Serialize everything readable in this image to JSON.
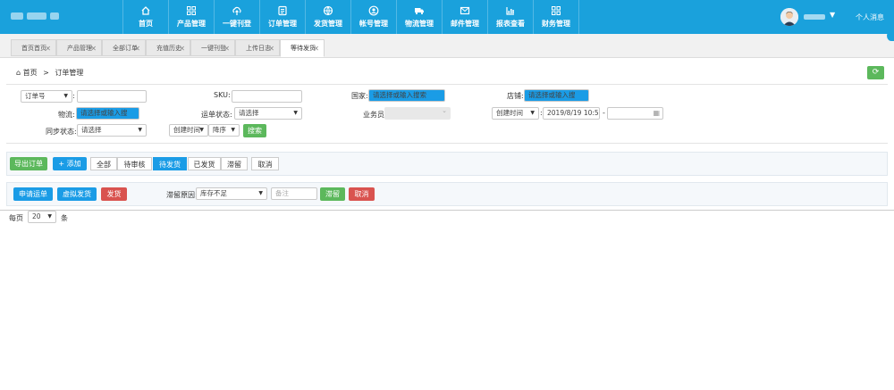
{
  "nav": [
    {
      "label": "首页",
      "icon": "home-icon"
    },
    {
      "label": "产品管理",
      "icon": "grid-icon"
    },
    {
      "label": "一键刊登",
      "icon": "cloud-upload-icon"
    },
    {
      "label": "订单管理",
      "icon": "document-icon"
    },
    {
      "label": "发货管理",
      "icon": "globe-icon"
    },
    {
      "label": "帐号管理",
      "icon": "user-icon"
    },
    {
      "label": "物流管理",
      "icon": "truck-icon"
    },
    {
      "label": "邮件管理",
      "icon": "mail-icon"
    },
    {
      "label": "报表查看",
      "icon": "report-icon"
    },
    {
      "label": "财务管理",
      "icon": "grid-icon"
    }
  ],
  "header": {
    "message_label": "个人消息"
  },
  "tabs": [
    "首页首页",
    "产品管理",
    "全部订单",
    "充值历史",
    "一键刊登",
    "上传日志",
    "等待发货"
  ],
  "active_tab": "等待发货",
  "breadcrumb": {
    "home": "首页",
    "separator": ">",
    "current": "订单管理"
  },
  "filters": {
    "order_no_select": "订单号",
    "colon": ":",
    "sku_label": "SKU:",
    "country_label": "国家:",
    "country_placeholder": "请选择或输入搜索",
    "shop_label": "店铺:",
    "shop_placeholder": "请选择或输入搜",
    "logistics_label": "物流:",
    "logistics_placeholder": "请选择或输入搜",
    "waybill_status_label": "运单状态:",
    "waybill_status_value": "请选择",
    "salesman_label": "业务员:",
    "created_time_select": "创建时间",
    "created_time_value": "2019/8/19 10:5",
    "range_dash": "-",
    "sync_status_label": "同步状态:",
    "sync_status_value": "请选择",
    "sort_field": "创建时间",
    "sort_order": "降序",
    "search_button": "搜索"
  },
  "toolbar": {
    "export_button": "导出订单",
    "add_button": "+ 添加",
    "status_tabs": [
      "全部",
      "待审核",
      "待发货",
      "已发货",
      "滞留",
      "取消"
    ],
    "active_status": "待发货"
  },
  "actions": {
    "apply_waybill": "申请运单",
    "virtual_ship": "虚拟发货",
    "ship": "发货",
    "hold_reason_label": "滞留原因:",
    "hold_reason_value": "库存不足",
    "remark_placeholder": "备注",
    "hold_button": "滞留",
    "cancel_button": "取消"
  },
  "pager": {
    "per_page_label": "每页",
    "per_page_value": "20",
    "unit": "条"
  },
  "colors": {
    "topbar": "#1aa1dc",
    "green": "#5cb85c",
    "blue": "#1a9ce6",
    "red": "#d9534f"
  }
}
